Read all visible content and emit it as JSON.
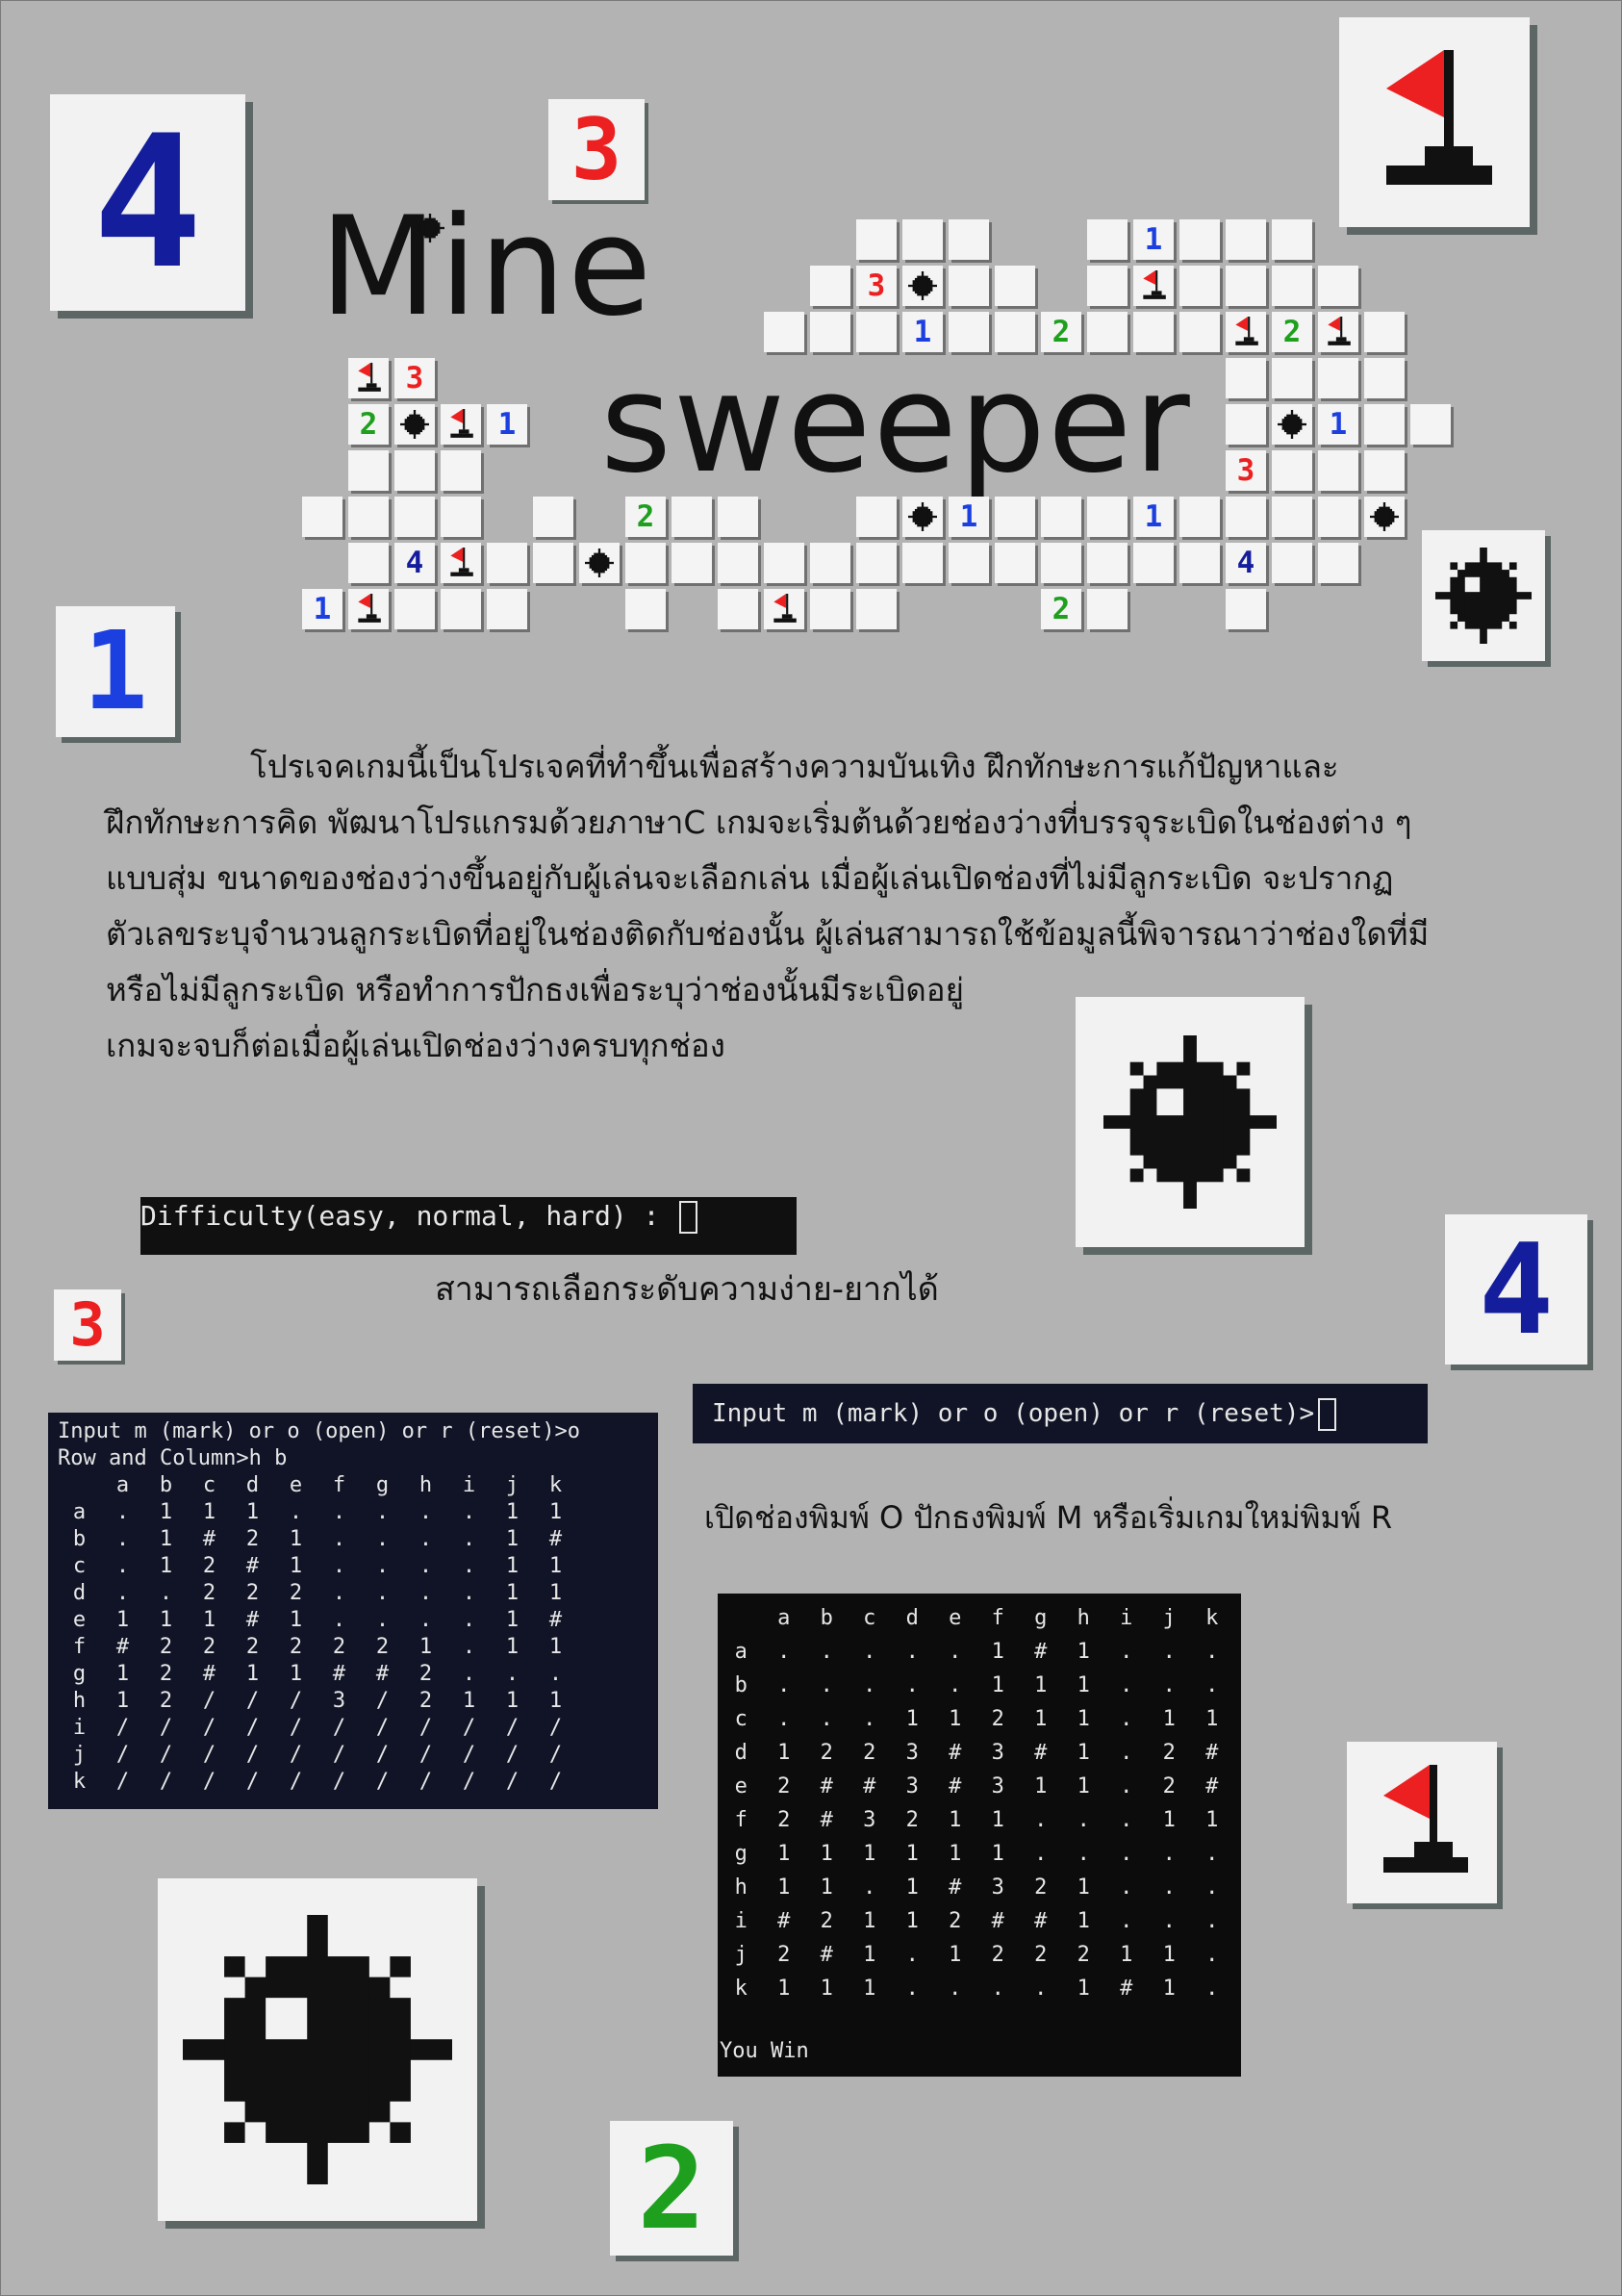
{
  "title": {
    "line1": "Mine",
    "line2": "sweeper"
  },
  "colors": {
    "one": "#1c3fe0",
    "two": "#1ea01e",
    "three": "#ec2020",
    "four": "#141e9c",
    "background": "#b3b3b3",
    "terminal": "#101426"
  },
  "icons": {
    "flag": "flag-icon",
    "mine": "mine-icon"
  },
  "corner_tiles": {
    "four_top_left": "4",
    "three_top": "3",
    "one_left": "1",
    "four_right": "4",
    "three_left": "3",
    "two_bottom": "2"
  },
  "description": [
    "โปรเจคเกมนี้เป็นโปรเจคที่ทำขึ้นเพื่อสร้างความบันเทิง ฝึกทักษะการแก้ปัญหาและ",
    "ฝึกทักษะการคิด พัฒนาโปรแกรมด้วยภาษาC เกมจะเริ่มต้นด้วยช่องว่างที่บรรจุระเบิดในช่องต่าง ๆ",
    "แบบสุ่ม ขนาดของช่องว่างขึ้นอยู่กับผู้เล่นจะเลือกเล่น เมื่อผู้เล่นเปิดช่องที่ไม่มีลูกระเบิด จะปรากฏ",
    "ตัวเลขระบุจำนวนลูกระเบิดที่อยู่ในช่องติดกับช่องนั้น ผู้เล่นสามารถใช้ข้อมูลนี้พิจารณาว่าช่องใดที่มี",
    "หรือไม่มีลูกระเบิด หรือทำการปักธงเพื่อระบุว่าช่องนั้นมีระเบิดอยู่",
    "เกมจะจบก็ต่อเมื่อผู้เล่นเปิดช่องว่างครบทุกช่อง"
  ],
  "difficulty": {
    "prompt": "Difficulty(easy, normal, hard) : ",
    "caption": "สามารถเลือกระดับความง่าย-ยากได้"
  },
  "input_prompt": {
    "prompt": "Input m (mark) or o (open) or r (reset)>",
    "caption": "เปิดช่องพิมพ์ O ปักธงพิมพ์ M หรือเริ่มเกมใหม่พิมพ์ R"
  },
  "terminal_left": {
    "line1": "Input m (mark) or o (open) or r (reset)>o",
    "line2": "Row and Column>h b",
    "columns": [
      "a",
      "b",
      "c",
      "d",
      "e",
      "f",
      "g",
      "h",
      "i",
      "j",
      "k"
    ],
    "rows": [
      [
        "a",
        ".",
        "1",
        "1",
        "1",
        ".",
        ".",
        ".",
        ".",
        ".",
        "1",
        "1"
      ],
      [
        "b",
        ".",
        "1",
        "#",
        "2",
        "1",
        ".",
        ".",
        ".",
        ".",
        "1",
        "#"
      ],
      [
        "c",
        ".",
        "1",
        "2",
        "#",
        "1",
        ".",
        ".",
        ".",
        ".",
        "1",
        "1"
      ],
      [
        "d",
        ".",
        ".",
        "2",
        "2",
        "2",
        ".",
        ".",
        ".",
        ".",
        "1",
        "1"
      ],
      [
        "e",
        "1",
        "1",
        "1",
        "#",
        "1",
        ".",
        ".",
        ".",
        ".",
        "1",
        "#"
      ],
      [
        "f",
        "#",
        "2",
        "2",
        "2",
        "2",
        "2",
        "2",
        "1",
        ".",
        "1",
        "1"
      ],
      [
        "g",
        "1",
        "2",
        "#",
        "1",
        "1",
        "#",
        "#",
        "2",
        ".",
        ".",
        "."
      ],
      [
        "h",
        "1",
        "2",
        "/",
        "/",
        "/",
        "3",
        "/",
        "2",
        "1",
        "1",
        "1"
      ],
      [
        "i",
        "/",
        "/",
        "/",
        "/",
        "/",
        "/",
        "/",
        "/",
        "/",
        "/",
        "/"
      ],
      [
        "j",
        "/",
        "/",
        "/",
        "/",
        "/",
        "/",
        "/",
        "/",
        "/",
        "/",
        "/"
      ],
      [
        "k",
        "/",
        "/",
        "/",
        "/",
        "/",
        "/",
        "/",
        "/",
        "/",
        "/",
        "/"
      ]
    ]
  },
  "terminal_right": {
    "columns": [
      "a",
      "b",
      "c",
      "d",
      "e",
      "f",
      "g",
      "h",
      "i",
      "j",
      "k"
    ],
    "rows": [
      [
        "a",
        ".",
        ".",
        ".",
        ".",
        ".",
        "1",
        "#",
        "1",
        ".",
        ".",
        "."
      ],
      [
        "b",
        ".",
        ".",
        ".",
        ".",
        ".",
        "1",
        "1",
        "1",
        ".",
        ".",
        "."
      ],
      [
        "c",
        ".",
        ".",
        ".",
        "1",
        "1",
        "2",
        "1",
        "1",
        ".",
        "1",
        "1"
      ],
      [
        "d",
        "1",
        "2",
        "2",
        "3",
        "#",
        "3",
        "#",
        "1",
        ".",
        "2",
        "#"
      ],
      [
        "e",
        "2",
        "#",
        "#",
        "3",
        "#",
        "3",
        "1",
        "1",
        ".",
        "2",
        "#"
      ],
      [
        "f",
        "2",
        "#",
        "3",
        "2",
        "1",
        "1",
        ".",
        ".",
        ".",
        "1",
        "1"
      ],
      [
        "g",
        "1",
        "1",
        "1",
        "1",
        "1",
        "1",
        ".",
        ".",
        ".",
        ".",
        "."
      ],
      [
        "h",
        "1",
        "1",
        ".",
        "1",
        "#",
        "3",
        "2",
        "1",
        ".",
        ".",
        "."
      ],
      [
        "i",
        "#",
        "2",
        "1",
        "1",
        "2",
        "#",
        "#",
        "1",
        ".",
        ".",
        "."
      ],
      [
        "j",
        "2",
        "#",
        "1",
        ".",
        "1",
        "2",
        "2",
        "2",
        "1",
        "1",
        "."
      ],
      [
        "k",
        "1",
        "1",
        "1",
        ".",
        ".",
        ".",
        ".",
        "1",
        "#",
        "1",
        "."
      ]
    ],
    "result": "You Win"
  },
  "board_numbers": {
    "n1": "1",
    "n2": "2",
    "n3": "3",
    "n4": "4"
  }
}
